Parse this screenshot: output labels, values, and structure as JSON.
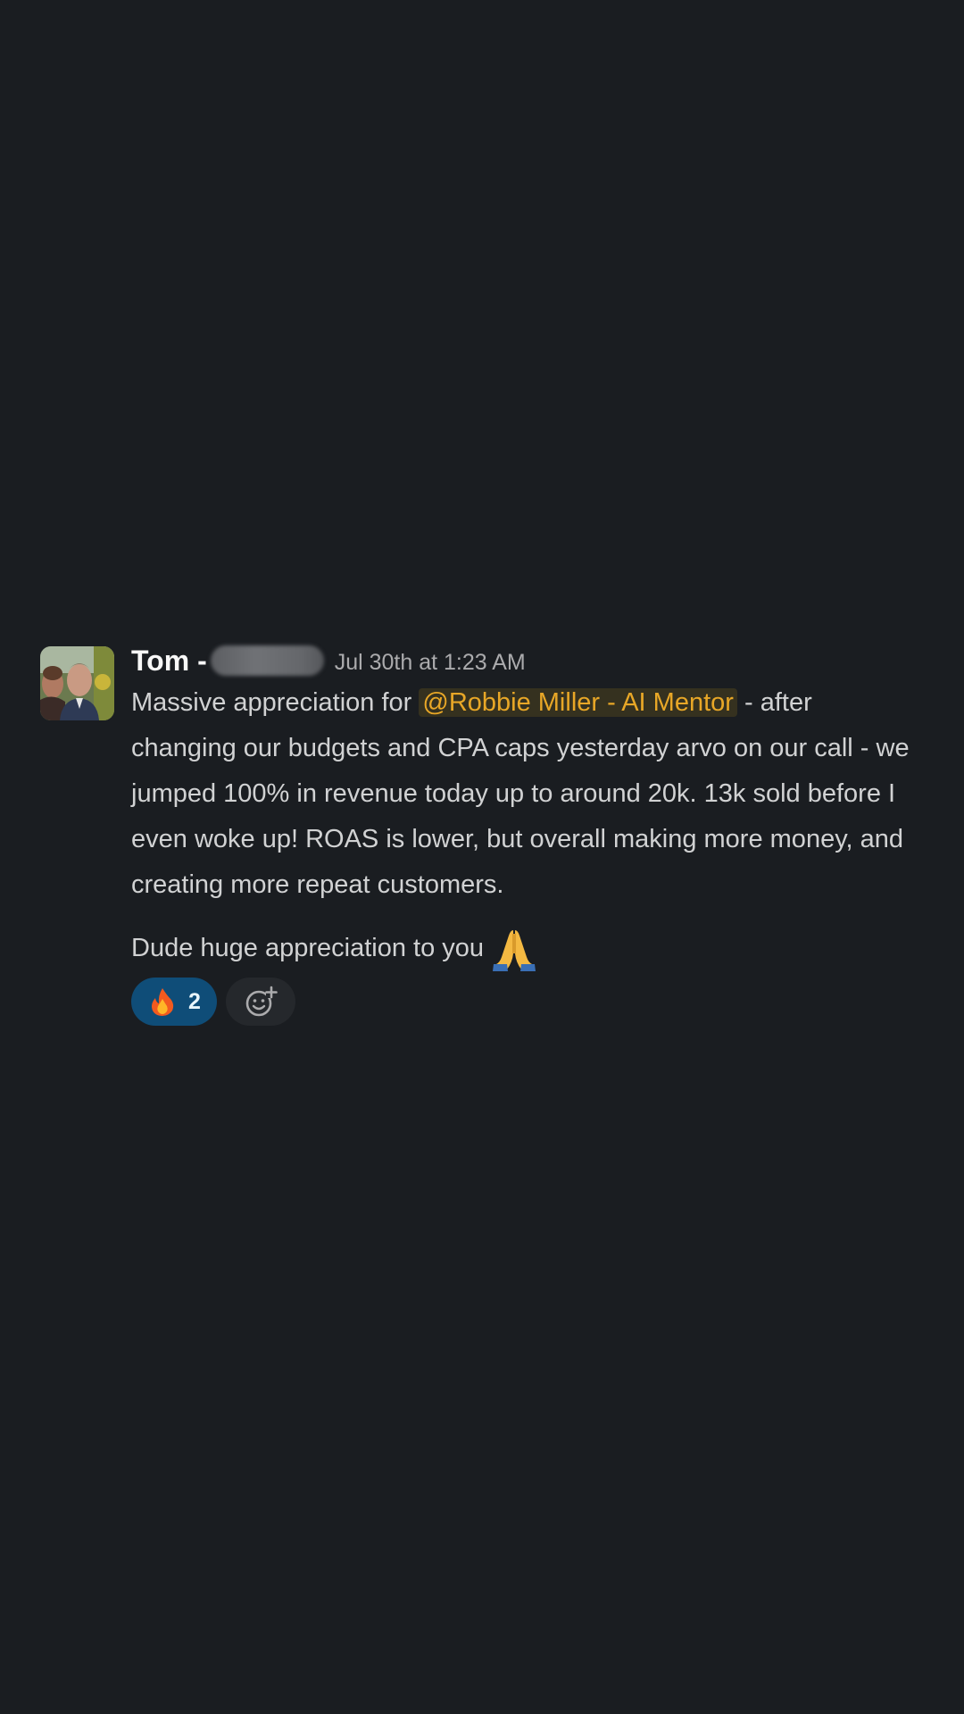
{
  "message": {
    "author": "Tom -",
    "timestamp": "Jul 30th at 1:23 AM",
    "text_before_mention": "Massive appreciation for ",
    "mention": "@Robbie Miller - AI Mentor",
    "text_after_mention": " - after changing our budgets and CPA caps yesterday arvo on our call - we jumped 100% in revenue today up to around 20k. 13k sold before I even woke up! ROAS is lower, but overall making more money, and creating more repeat customers.",
    "second_line": "Dude huge appreciation to you",
    "second_line_emoji": "folded-hands"
  },
  "reactions": [
    {
      "emoji": "fire",
      "count": "2"
    }
  ],
  "colors": {
    "background": "#1a1d21",
    "mention_text": "#e8a727",
    "reaction_active": "#0f4d78"
  }
}
